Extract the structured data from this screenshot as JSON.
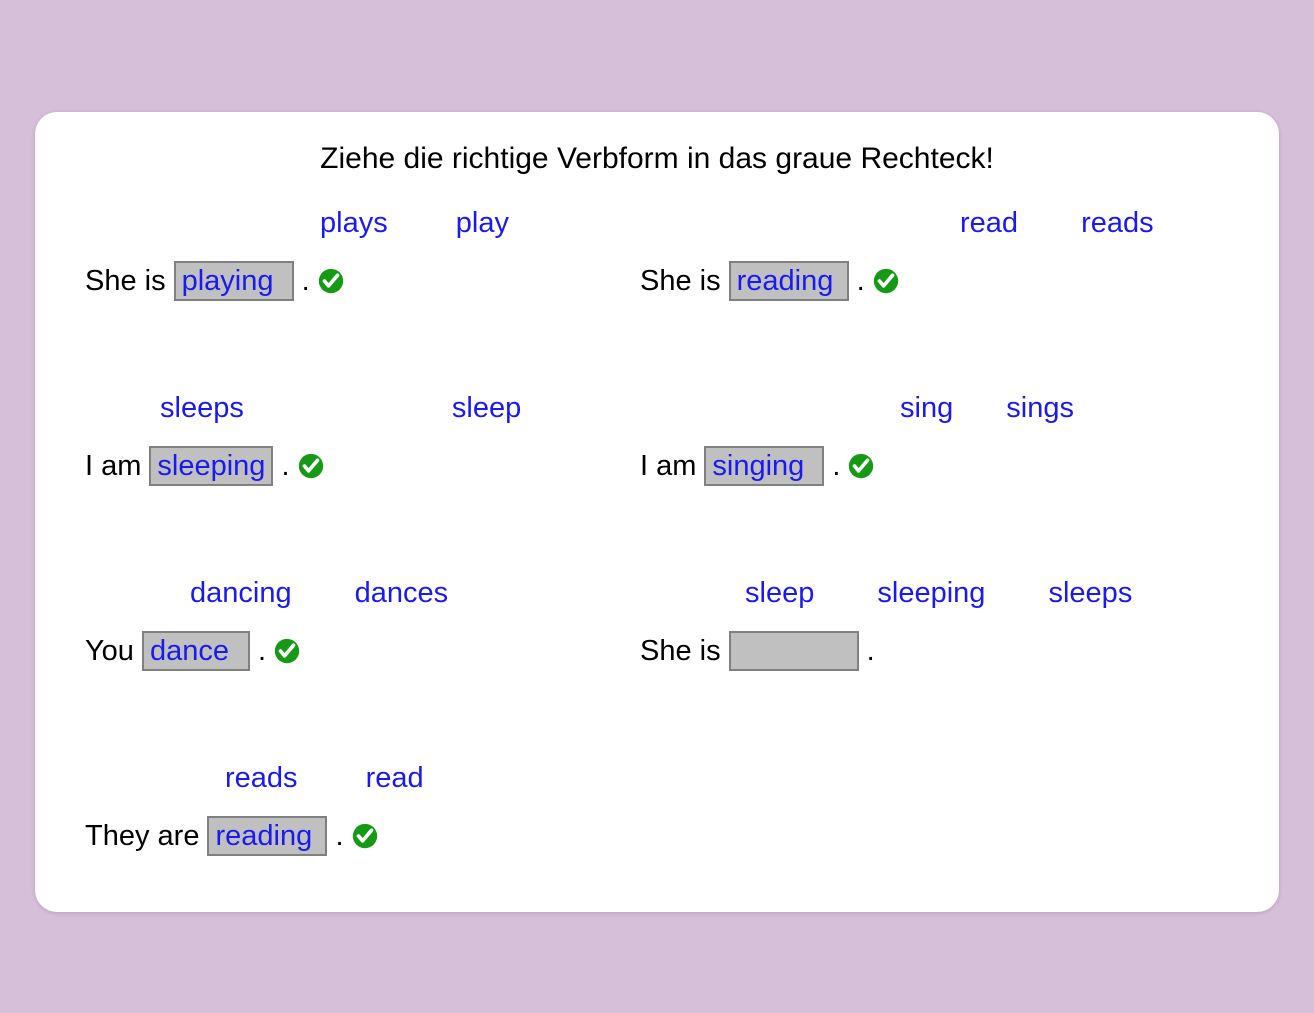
{
  "instruction": "Ziehe die richtige Verbform in das graue Rechteck!",
  "items": [
    {
      "prefix": "She is",
      "placed": "playing",
      "correct": true,
      "options": [
        "plays",
        "play"
      ]
    },
    {
      "prefix": "She is",
      "placed": "reading",
      "correct": true,
      "options": [
        "read",
        "reads"
      ]
    },
    {
      "prefix": "I am",
      "placed": "sleeping",
      "correct": true,
      "options": [
        "sleeps",
        "sleep"
      ]
    },
    {
      "prefix": "I am",
      "placed": "singing",
      "correct": true,
      "options": [
        "sing",
        "sings"
      ]
    },
    {
      "prefix": "You",
      "placed": "dance",
      "correct": true,
      "options": [
        "dancing",
        "dances"
      ]
    },
    {
      "prefix": "She is",
      "placed": "",
      "correct": false,
      "options": [
        "sleep",
        "sleeping",
        "sleeps"
      ]
    },
    {
      "prefix": "They are",
      "placed": "reading",
      "correct": true,
      "options": [
        "reads",
        "read"
      ]
    }
  ],
  "period": "."
}
